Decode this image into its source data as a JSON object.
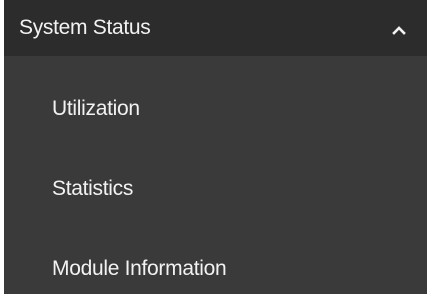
{
  "menu": {
    "section": {
      "title": "System Status",
      "expanded": true,
      "toggle_icon": "chevron-up-icon"
    },
    "items": [
      {
        "label": "Utilization"
      },
      {
        "label": "Statistics"
      },
      {
        "label": "Module Information"
      }
    ]
  },
  "colors": {
    "header_background": "#2c2c2c",
    "panel_background": "#3a3a3a",
    "text": "#f2f2f2"
  }
}
